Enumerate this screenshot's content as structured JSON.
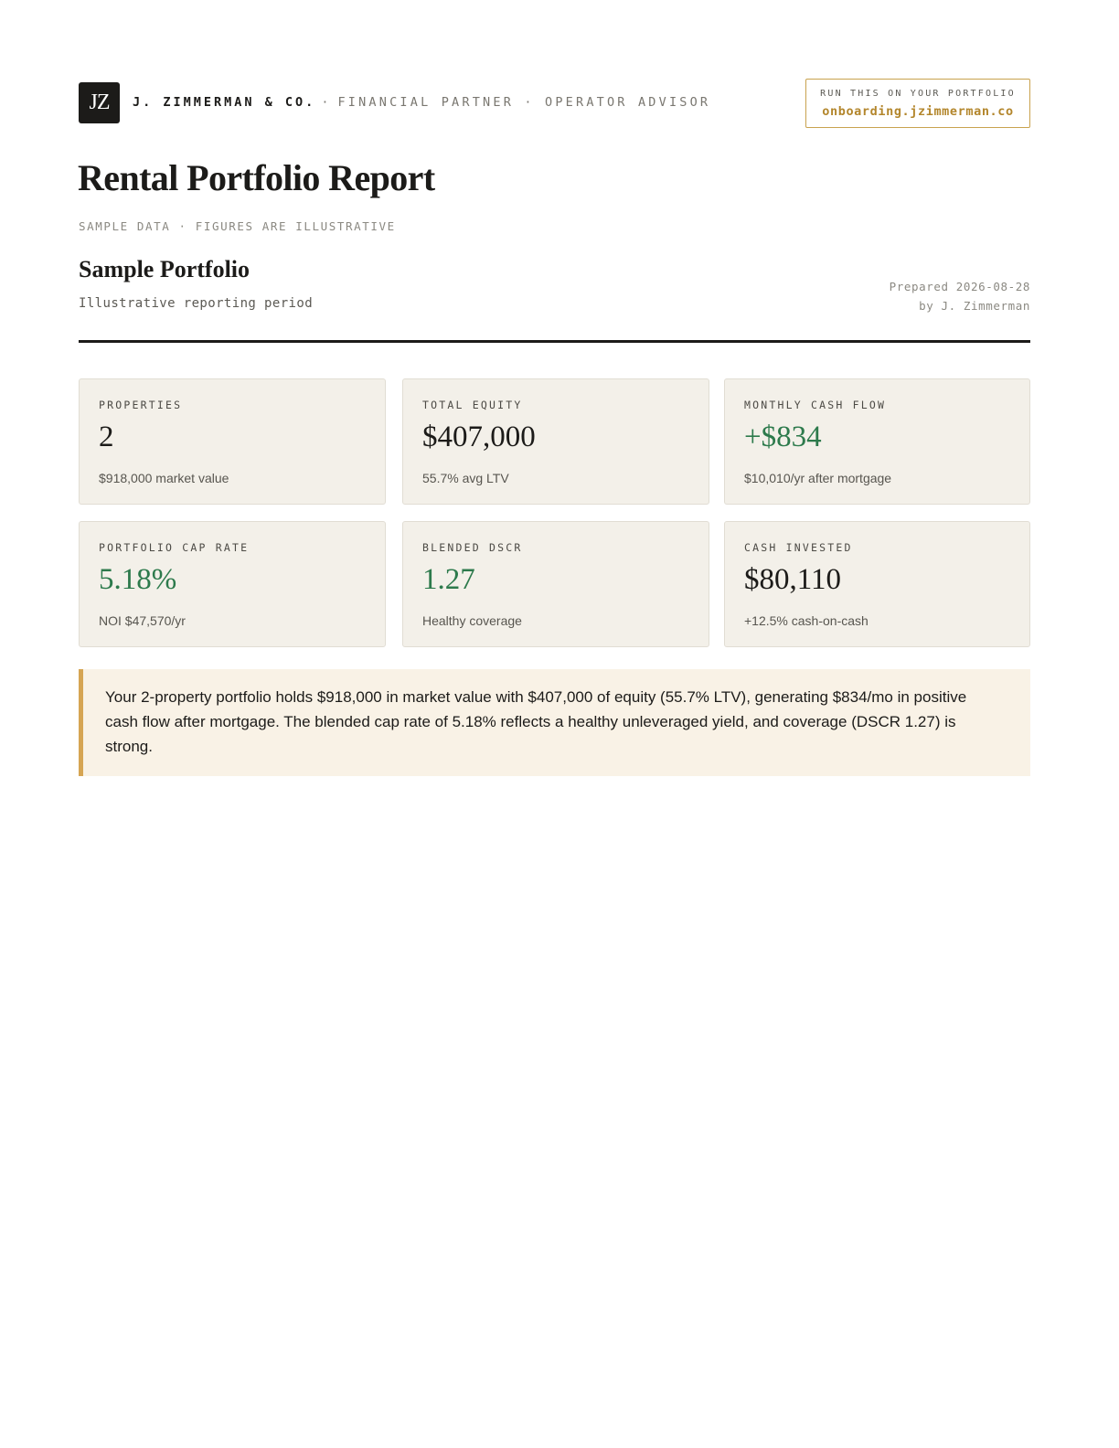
{
  "header": {
    "logo_text": "JZ",
    "brand_name": "J. ZIMMERMAN & CO.",
    "separator": "·",
    "tagline": "FINANCIAL PARTNER · OPERATOR ADVISOR",
    "cta_label": "RUN THIS ON YOUR PORTFOLIO",
    "cta_url": "onboarding.jzimmerman.co"
  },
  "report": {
    "title": "Rental Portfolio Report",
    "subtitle": "SAMPLE DATA · FIGURES ARE ILLUSTRATIVE",
    "portfolio_name": "Sample Portfolio",
    "period": "Illustrative reporting period",
    "prepared_line": "Prepared 2026-08-28",
    "prepared_by": "by J. Zimmerman"
  },
  "stats": [
    {
      "label": "PROPERTIES",
      "value": "2",
      "sub": "$918,000 market value",
      "tone": "neutral"
    },
    {
      "label": "TOTAL EQUITY",
      "value": "$407,000",
      "sub": "55.7% avg LTV",
      "tone": "neutral"
    },
    {
      "label": "MONTHLY CASH FLOW",
      "value": "+$834",
      "sub": "$10,010/yr after mortgage",
      "tone": "positive"
    },
    {
      "label": "PORTFOLIO CAP RATE",
      "value": "5.18%",
      "sub": "NOI $47,570/yr",
      "tone": "positive"
    },
    {
      "label": "BLENDED DSCR",
      "value": "1.27",
      "sub": "Healthy coverage",
      "tone": "positive"
    },
    {
      "label": "CASH INVESTED",
      "value": "$80,110",
      "sub": "+12.5% cash-on-cash",
      "tone": "neutral"
    }
  ],
  "summary": {
    "text": "Your 2-property portfolio holds $918,000 in market value with $407,000 of equity (55.7% LTV), generating $834/mo in positive cash flow after mortgage. The blended cap rate of 5.18% reflects a healthy unleveraged yield, and coverage (DSCR 1.27) is strong."
  },
  "colors": {
    "positive": "#2d7a4c",
    "accent_gold": "#c9a24e",
    "card_bg": "#f3f0e9",
    "callout_bg": "#f9f2e6"
  }
}
